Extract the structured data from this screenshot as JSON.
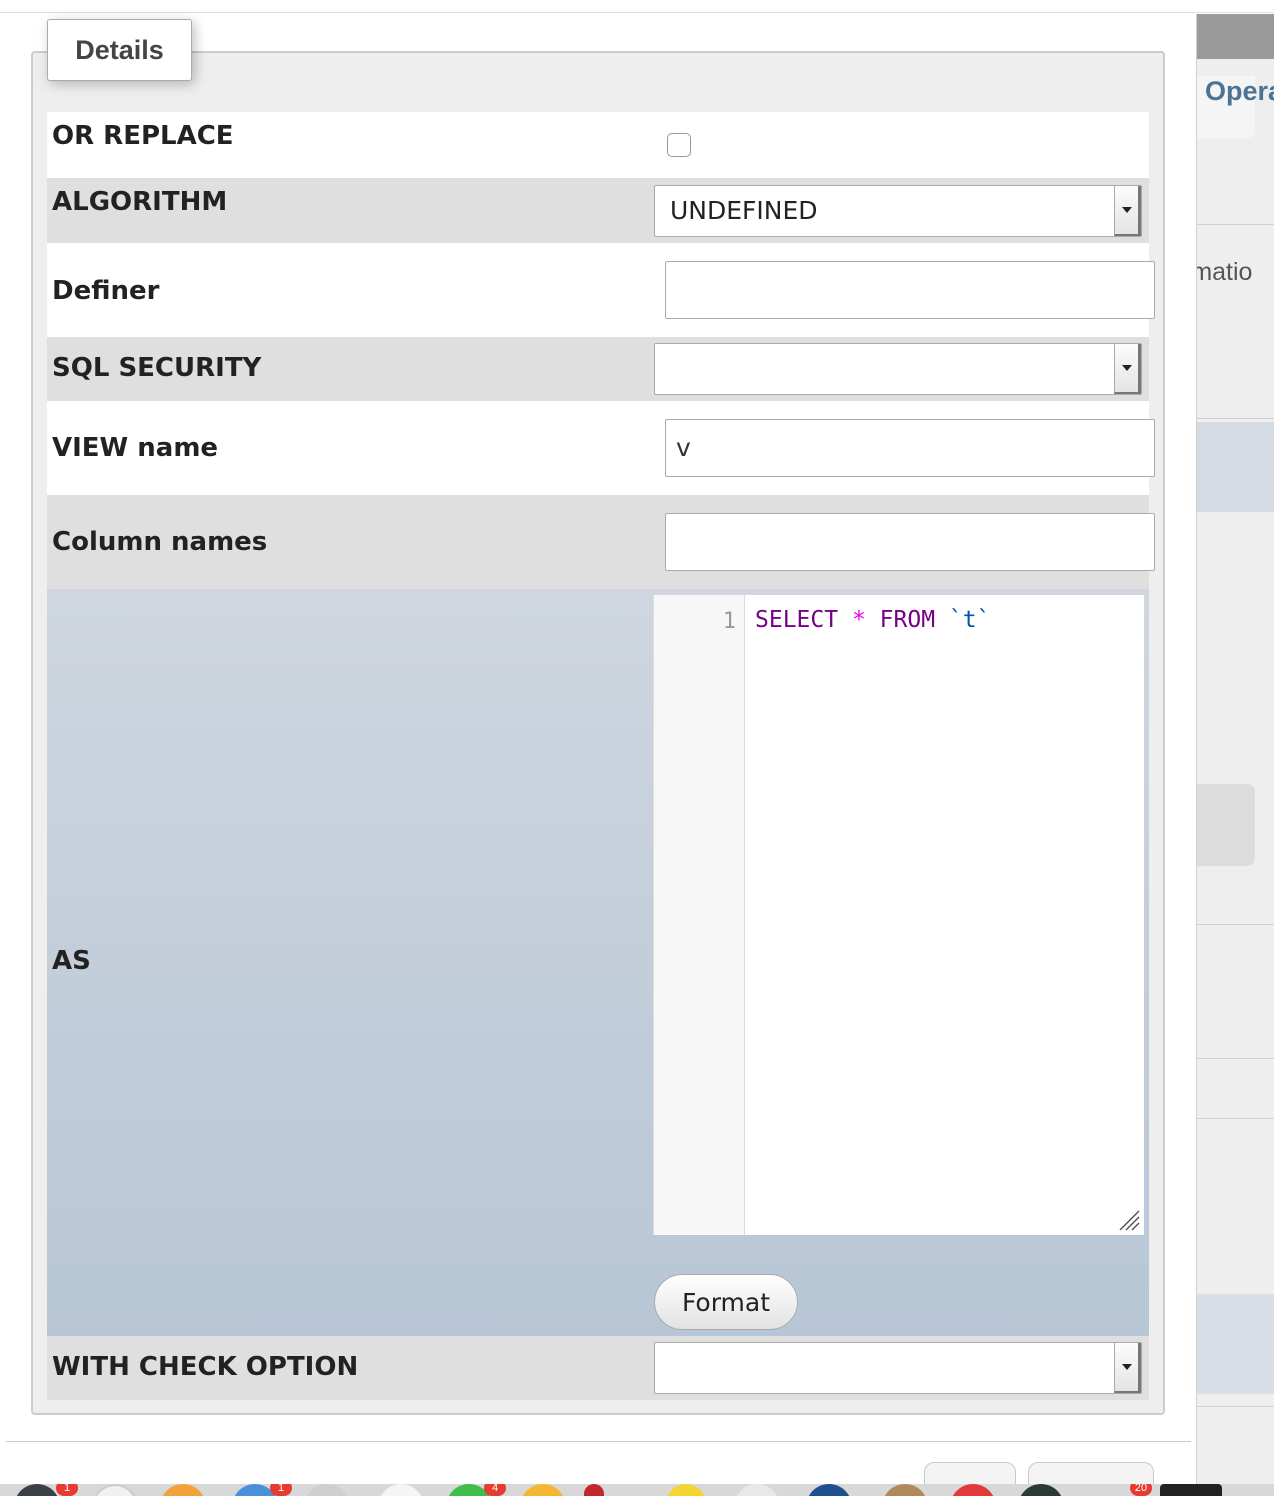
{
  "legend": "Details",
  "rows": {
    "or_replace": {
      "label": "OR REPLACE",
      "checked": false
    },
    "algorithm": {
      "label": "ALGORITHM",
      "value": "UNDEFINED"
    },
    "definer": {
      "label": "Definer",
      "value": ""
    },
    "sql_security": {
      "label": "SQL SECURITY",
      "value": ""
    },
    "view_name": {
      "label": "VIEW name",
      "value": "v"
    },
    "column_names": {
      "label": "Column names",
      "value": ""
    },
    "as": {
      "label": "AS",
      "line_number": "1",
      "sql": {
        "kw1": "SELECT",
        "star": "*",
        "kw2": "FROM",
        "table": "`t`"
      },
      "format_label": "Format"
    },
    "with_check_option": {
      "label": "WITH CHECK OPTION",
      "value": ""
    }
  },
  "background": {
    "tab_label_fragment": "Opera",
    "text_fragment": "rmatio"
  },
  "dock": {
    "badges": [
      "1",
      "1",
      "4",
      "20"
    ]
  }
}
